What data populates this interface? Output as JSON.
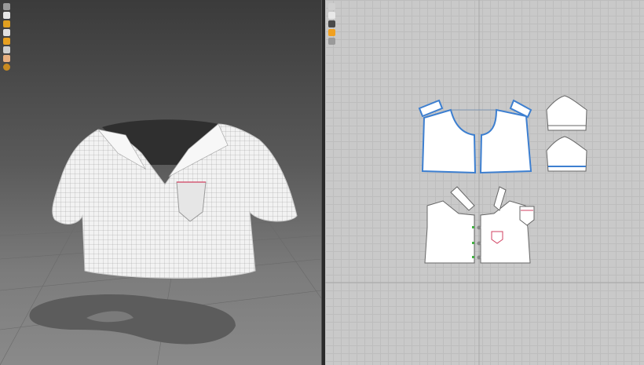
{
  "viewport_3d": {
    "toolbar": [
      {
        "icon": "display-avatar-icon",
        "color": "#9a9a9a"
      },
      {
        "icon": "garment-icon",
        "color": "#e6e6e6"
      },
      {
        "icon": "texture-icon",
        "color": "#e0a020"
      },
      {
        "icon": "avatar-icon",
        "color": "#e0e0e0"
      },
      {
        "icon": "show-3d-pattern-icon",
        "color": "#e8a020"
      },
      {
        "icon": "arrangement-icon",
        "color": "#cfcfcf"
      },
      {
        "icon": "body-icon",
        "color": "#e8b080"
      },
      {
        "icon": "fabric-icon",
        "color": "#c88a20"
      }
    ],
    "colors": {
      "background_top": "#3b3b3b",
      "background_bottom": "#8a8a8a",
      "garment": "#f2f2f2",
      "shadow": "#5c5c5c"
    }
  },
  "window_2d": {
    "toolbar": [
      {
        "icon": "pattern-edit-icon",
        "color": "#d0d0d0"
      },
      {
        "icon": "show-grid-icon",
        "color": "#e8e8e8"
      },
      {
        "icon": "texture-2d-icon",
        "color": "#4a4a4a"
      },
      {
        "icon": "pattern-color-icon",
        "color": "#f0a020"
      },
      {
        "icon": "layer-icon",
        "color": "#9a9a9a"
      }
    ],
    "colors": {
      "background": "#c9c9c9",
      "selected_outline": "#3d7fd0",
      "piece_fill": "#ffffff",
      "seam": "#7a7a7a"
    }
  }
}
